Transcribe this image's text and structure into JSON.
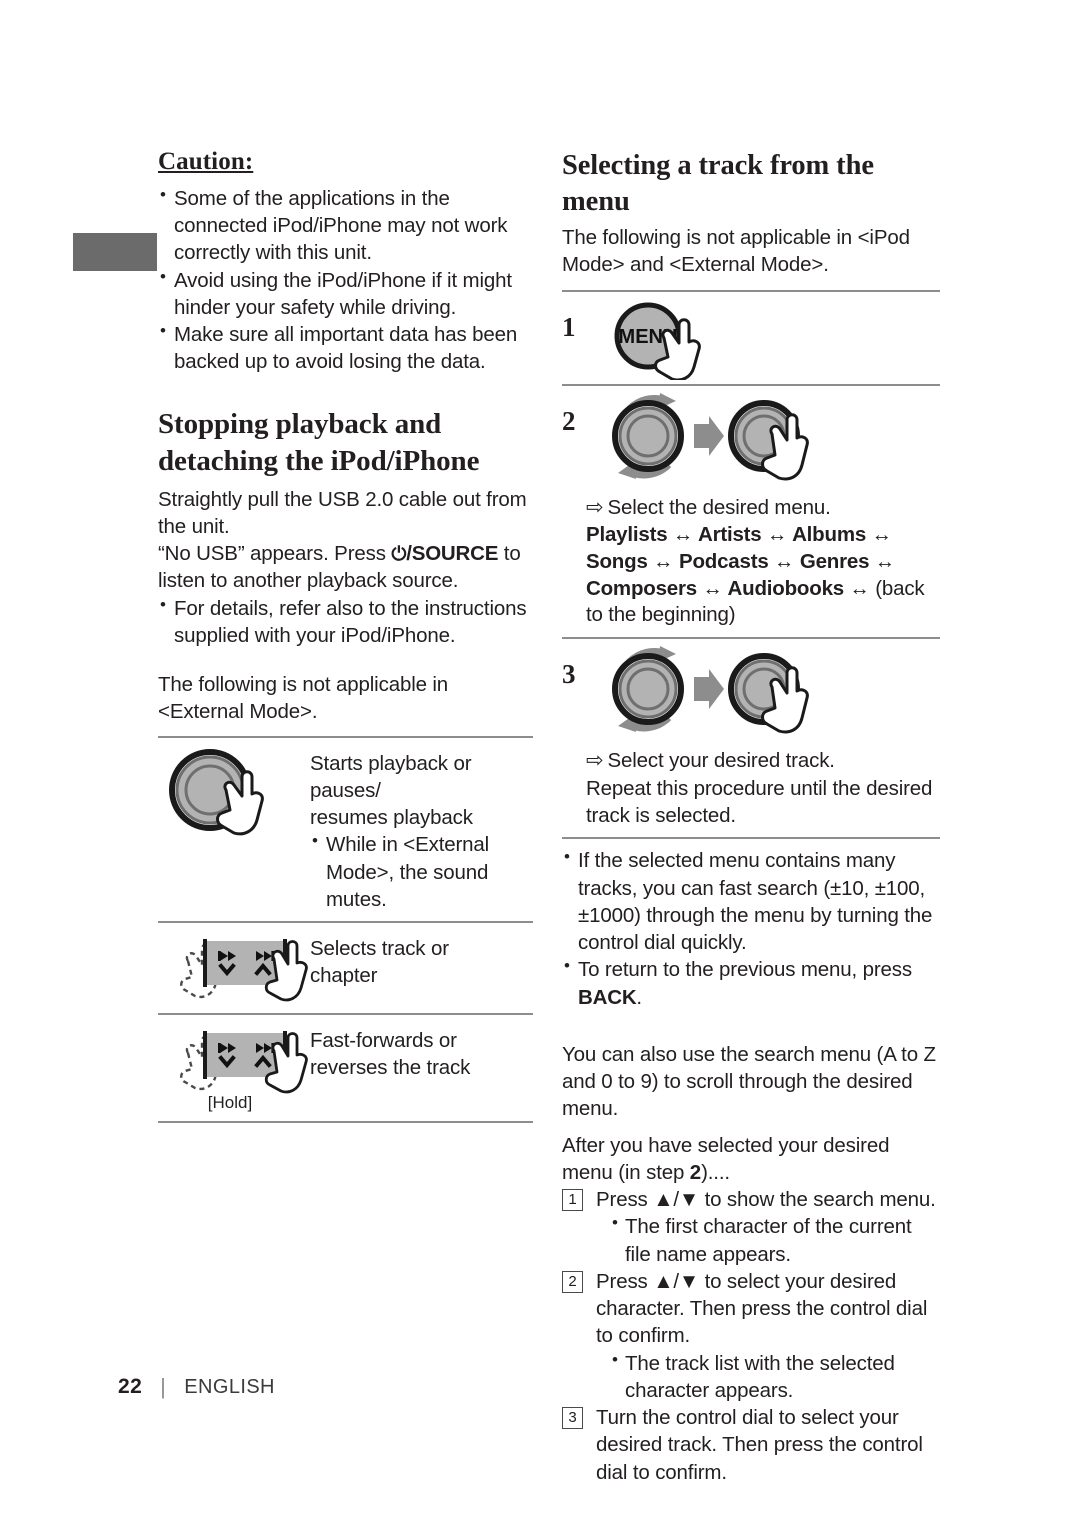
{
  "page": {
    "number": "22",
    "language": "ENGLISH",
    "separator": "|"
  },
  "left_column": {
    "caution": {
      "heading": "Caution:",
      "bullets": [
        "Some of the applications in the connected iPod/iPhone may not work correctly with this unit.",
        "Avoid using the iPod/iPhone if it might hinder your safety while driving.",
        "Make sure all important data has been backed up to avoid losing the data."
      ]
    },
    "stopping": {
      "heading": "Stopping playback and detaching the iPod/iPhone",
      "para1": "Straightly pull the USB 2.0 cable out from the unit.",
      "para2_before": "“No USB” appears. Press ",
      "para2_key_power": "⏻",
      "para2_key_label": "/SOURCE",
      "para2_after": " to listen to another playback source.",
      "bullets": [
        "For details, refer also to the instructions supplied with your iPod/iPhone."
      ],
      "note": "The following is not applicable in <External Mode>."
    },
    "control_table": {
      "rows": [
        {
          "icon": "control-dial-press",
          "text_lines": [
            "Starts playback or pauses/",
            "resumes playback"
          ],
          "bullets": [
            "While in <External Mode>, the sound mutes."
          ]
        },
        {
          "icon": "track-buttons",
          "icon_caption": "",
          "text_lines": [
            "Selects track or",
            "chapter"
          ],
          "bullets": []
        },
        {
          "icon": "track-buttons-hold",
          "icon_caption": "[Hold]",
          "text_lines": [
            "Fast-forwards or",
            "reverses the track"
          ],
          "bullets": []
        }
      ]
    }
  },
  "right_column": {
    "heading": "Selecting a track from the menu",
    "intro": "The following is not applicable in <iPod Mode> and <External Mode>.",
    "steps": [
      {
        "num": "1",
        "icon": "menu-button-press",
        "button_label": "MENU",
        "notes": []
      },
      {
        "num": "2",
        "icon": "dial-turn-then-press",
        "notes": [
          {
            "arrow": "⇨",
            "text": "Select the desired menu."
          }
        ],
        "menu_chain": {
          "items": [
            "Playlists",
            "Artists",
            "Albums",
            "Songs",
            "Podcasts",
            "Genres",
            "Composers",
            "Audiobooks"
          ],
          "arrow": "↔",
          "tail": "(back to the beginning)"
        }
      },
      {
        "num": "3",
        "icon": "dial-turn-then-press",
        "notes": [
          {
            "arrow": "⇨",
            "text": "Select your desired track."
          },
          {
            "arrow": "",
            "text": "Repeat this procedure until the desired track is selected."
          }
        ]
      }
    ],
    "tips": [
      "If the selected menu contains many tracks, you can fast search (±10, ±100, ±1000) through the menu by turning the control dial quickly.",
      "To return to the previous menu, press BACK."
    ],
    "tip2_before": "To return to the previous menu, press ",
    "tip2_key": "BACK",
    "tip2_after": ".",
    "search_intro": "You can also use the search menu (A to Z and 0 to 9) to scroll through the desired menu.",
    "search_lead_before": "After you have selected your desired menu (in step ",
    "search_lead_step": "2",
    "search_lead_after": ")....",
    "search_steps": [
      {
        "num": "1",
        "text": "Press ▲/▼ to show the search menu.",
        "subbullets": [
          "The first character of the current file name appears."
        ]
      },
      {
        "num": "2",
        "text": "Press ▲/▼ to select your desired character. Then press the control dial to confirm.",
        "subbullets": [
          "The track list with the selected character appears."
        ]
      },
      {
        "num": "3",
        "text": "Turn the control dial to select your desired track. Then press the control dial to confirm.",
        "subbullets": []
      }
    ]
  },
  "colors": {
    "rule": "#8d8d8d",
    "tab": "#6b6b6b",
    "icon_fill": "#b3b3b3",
    "icon_stroke": "#1a1a1a",
    "text": "#231f20"
  }
}
